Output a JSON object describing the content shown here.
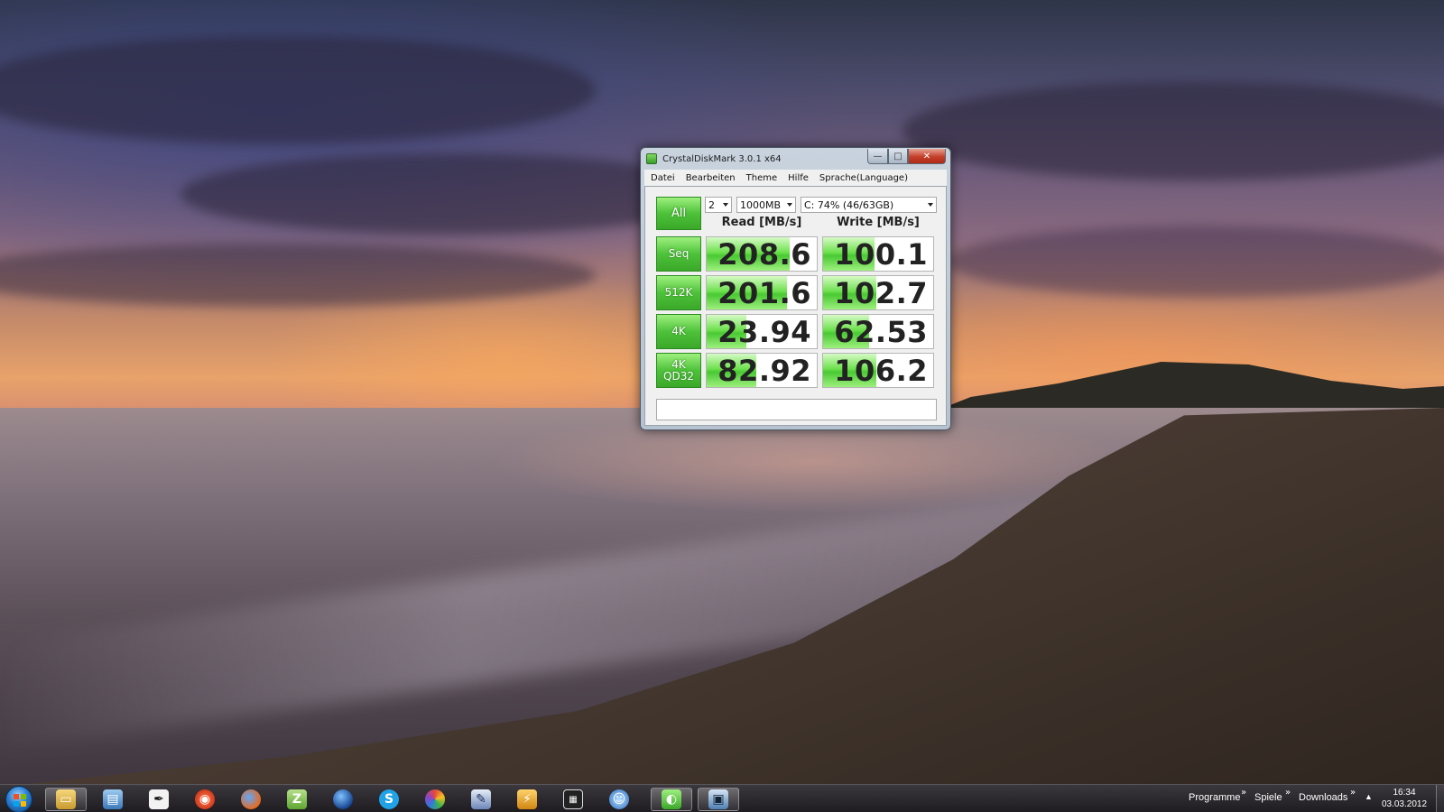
{
  "window": {
    "title": "CrystalDiskMark 3.0.1 x64",
    "controls": {
      "minimize": "—",
      "maximize": "□",
      "close": "✕"
    }
  },
  "menu": [
    "Datei",
    "Bearbeiten",
    "Theme",
    "Hilfe",
    "Sprache(Language)"
  ],
  "controls": {
    "all_label": "All",
    "test_count": "2",
    "test_size": "1000MB",
    "drive": "C: 74% (46/63GB)"
  },
  "headers": {
    "read": "Read [MB/s]",
    "write": "Write [MB/s]"
  },
  "rows": [
    {
      "label": "Seq",
      "read": "208.6",
      "write": "100.1",
      "read_fill": 0.75,
      "write_fill": 0.47
    },
    {
      "label": "512K",
      "read": "201.6",
      "write": "102.7",
      "read_fill": 0.73,
      "write_fill": 0.48
    },
    {
      "label": "4K",
      "read": "23.94",
      "write": "62.53",
      "read_fill": 0.36,
      "write_fill": 0.42
    },
    {
      "label": "4K\nQD32",
      "read": "82.92",
      "write": "106.2",
      "read_fill": 0.45,
      "write_fill": 0.48
    }
  ],
  "comment": "",
  "taskbar": {
    "icons": [
      "explorer-icon",
      "remote-desktop-icon",
      "inkscape-icon",
      "nero-icon",
      "firefox-icon",
      "zim-icon",
      "google-earth-icon",
      "skype-icon",
      "picasa-icon",
      "photo-editor-icon",
      "transmission-icon",
      "video-editor-icon",
      "instant-messenger-icon",
      "crystaldiskmark-icon",
      "remote-app-icon"
    ],
    "toolbars": [
      "Programme",
      "Spiele",
      "Downloads"
    ],
    "time": "16:34",
    "date": "03.03.2012"
  },
  "colors": {
    "button_green": "#4ec23a",
    "bar_green": "#6fe14f",
    "close_red": "#c4402b"
  }
}
